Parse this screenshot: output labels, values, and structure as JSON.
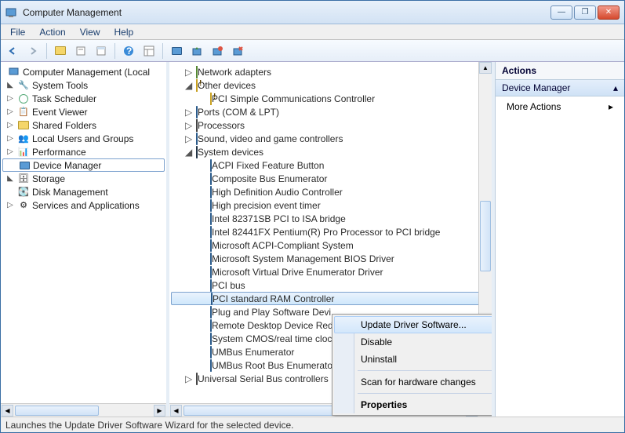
{
  "window": {
    "title": "Computer Management"
  },
  "menu": [
    "File",
    "Action",
    "View",
    "Help"
  ],
  "left_tree": {
    "root": "Computer Management (Local",
    "system_tools": {
      "label": "System Tools",
      "children": [
        "Task Scheduler",
        "Event Viewer",
        "Shared Folders",
        "Local Users and Groups",
        "Performance",
        "Device Manager"
      ]
    },
    "storage": {
      "label": "Storage",
      "children": [
        "Disk Management"
      ]
    },
    "services": {
      "label": "Services and Applications"
    }
  },
  "center": {
    "top": [
      {
        "label": "Network adapters",
        "expand": "►",
        "icon": "net"
      },
      {
        "label": "Other devices",
        "expand": "▲",
        "icon": "warn-folder",
        "children": [
          {
            "label": "PCI Simple Communications Controller",
            "icon": "warn"
          }
        ]
      },
      {
        "label": "Ports (COM & LPT)",
        "expand": "►",
        "icon": "port"
      },
      {
        "label": "Processors",
        "expand": "►",
        "icon": "chip"
      },
      {
        "label": "Sound, video and game controllers",
        "expand": "►",
        "icon": "sound"
      },
      {
        "label": "System devices",
        "expand": "▲",
        "icon": "computer",
        "children": [
          {
            "label": "ACPI Fixed Feature Button"
          },
          {
            "label": "Composite Bus Enumerator"
          },
          {
            "label": "High Definition Audio Controller"
          },
          {
            "label": "High precision event timer"
          },
          {
            "label": "Intel 82371SB PCI to ISA bridge"
          },
          {
            "label": "Intel 82441FX Pentium(R) Pro Processor to PCI bridge"
          },
          {
            "label": "Microsoft ACPI-Compliant System"
          },
          {
            "label": "Microsoft System Management BIOS Driver"
          },
          {
            "label": "Microsoft Virtual Drive Enumerator Driver"
          },
          {
            "label": "PCI bus"
          },
          {
            "label": "PCI standard RAM Controller",
            "selected": true
          },
          {
            "label": "Plug and Play Software Devi"
          },
          {
            "label": "Remote Desktop Device Red"
          },
          {
            "label": "System CMOS/real time cloc"
          },
          {
            "label": "UMBus Enumerator"
          },
          {
            "label": "UMBus Root Bus Enumerato"
          }
        ]
      },
      {
        "label": "Universal Serial Bus controllers",
        "expand": "►",
        "icon": "usb"
      }
    ]
  },
  "context_menu": {
    "items": [
      {
        "label": "Update Driver Software...",
        "hover": true
      },
      {
        "label": "Disable"
      },
      {
        "label": "Uninstall"
      },
      {
        "sep": true
      },
      {
        "label": "Scan for hardware changes"
      },
      {
        "sep": true
      },
      {
        "label": "Properties",
        "bold": true
      }
    ]
  },
  "actions": {
    "header": "Actions",
    "sub": "Device Manager",
    "more": "More Actions"
  },
  "statusbar": "Launches the Update Driver Software Wizard for the selected device."
}
